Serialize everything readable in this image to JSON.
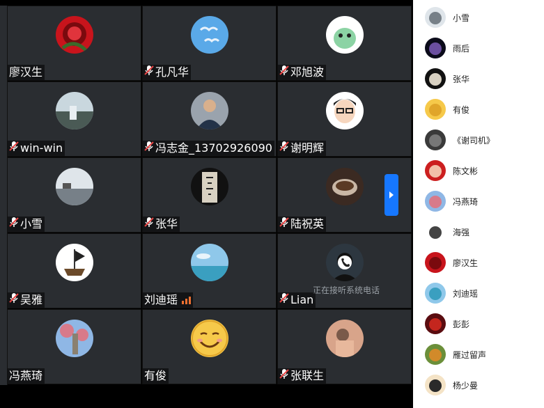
{
  "grid_tiles": [
    {
      "name": "廖汉生",
      "mic_off": false,
      "avatar": "red-rose",
      "colors": [
        "#c8141c",
        "#7a0a0e"
      ]
    },
    {
      "name": "孔凡华",
      "mic_off": true,
      "avatar": "seagulls-sky",
      "colors": [
        "#5aa9e8",
        "#e8f2fb"
      ]
    },
    {
      "name": "邓旭波",
      "mic_off": true,
      "avatar": "green-cartoon",
      "colors": [
        "#ffffff",
        "#8cd3a4"
      ]
    },
    {
      "name": "win-win",
      "mic_off": true,
      "avatar": "waterfall",
      "colors": [
        "#c9d7de",
        "#4a5a55"
      ]
    },
    {
      "name": "冯志金_13702926090",
      "mic_off": true,
      "avatar": "man-suit",
      "colors": [
        "#9aa3ad",
        "#233248"
      ]
    },
    {
      "name": "谢明辉",
      "mic_off": true,
      "avatar": "cartoon-man",
      "colors": [
        "#ffffff",
        "#222222"
      ]
    },
    {
      "name": "小雪",
      "mic_off": true,
      "avatar": "lake-pavilion",
      "colors": [
        "#dfe5ea",
        "#778088"
      ]
    },
    {
      "name": "张华",
      "mic_off": true,
      "avatar": "calligraphy",
      "colors": [
        "#111111",
        "#d8d1c2"
      ]
    },
    {
      "name": "陆祝英",
      "mic_off": true,
      "avatar": "teacup",
      "colors": [
        "#3b2a22",
        "#c9b7a5"
      ]
    },
    {
      "name": "吴雅",
      "mic_off": true,
      "avatar": "pirate-ship",
      "colors": [
        "#ffffff",
        "#6b4a2a"
      ]
    },
    {
      "name": "刘迪瑶",
      "mic_off": false,
      "avatar": "sea-sky",
      "colors": [
        "#8fc8ea",
        "#3a9fc0"
      ],
      "signal_bars": 3
    },
    {
      "name": "Lian",
      "mic_off": true,
      "avatar": "phone-call",
      "colors": [
        "#2d3740",
        "#111"
      ],
      "status": "正在接听系统电话"
    },
    {
      "name": "冯燕琦",
      "mic_off": false,
      "avatar": "blossom-tower",
      "colors": [
        "#8fb7e5",
        "#d87a8a"
      ]
    },
    {
      "name": "有俊",
      "mic_off": false,
      "avatar": "smiley",
      "colors": [
        "#f6c94a",
        "#e0a52a"
      ]
    },
    {
      "name": "张联生",
      "mic_off": true,
      "avatar": "person-photo",
      "colors": [
        "#d8a48a",
        "#7a5a4a"
      ]
    }
  ],
  "members": [
    {
      "name": "小雪",
      "colors": [
        "#dfe5ea",
        "#778088"
      ]
    },
    {
      "name": "雨后",
      "colors": [
        "#0b0b1a",
        "#6b4fa0"
      ]
    },
    {
      "name": "张华",
      "colors": [
        "#111111",
        "#d8d1c2"
      ]
    },
    {
      "name": "有俊",
      "colors": [
        "#f6c94a",
        "#e0a52a"
      ]
    },
    {
      "name": "《谢司机》",
      "colors": [
        "#3a3a3a",
        "#777777"
      ]
    },
    {
      "name": "陈文彬",
      "colors": [
        "#cc1f1f",
        "#f2c0a8"
      ]
    },
    {
      "name": "冯燕琦",
      "colors": [
        "#8fb7e5",
        "#d87a8a"
      ]
    },
    {
      "name": "海强",
      "colors": [
        "#ffffff",
        "#444444"
      ]
    },
    {
      "name": "廖汉生",
      "colors": [
        "#c8141c",
        "#7a0a0e"
      ]
    },
    {
      "name": "刘迪瑶",
      "colors": [
        "#8fc8ea",
        "#3a9fc0"
      ]
    },
    {
      "name": "彭彭",
      "colors": [
        "#5a0c10",
        "#c4261e"
      ]
    },
    {
      "name": "雁过留声",
      "colors": [
        "#6b8f3a",
        "#d28a2a"
      ]
    },
    {
      "name": "杨少曼",
      "colors": [
        "#f4e3c6",
        "#2a2a2a"
      ]
    }
  ]
}
